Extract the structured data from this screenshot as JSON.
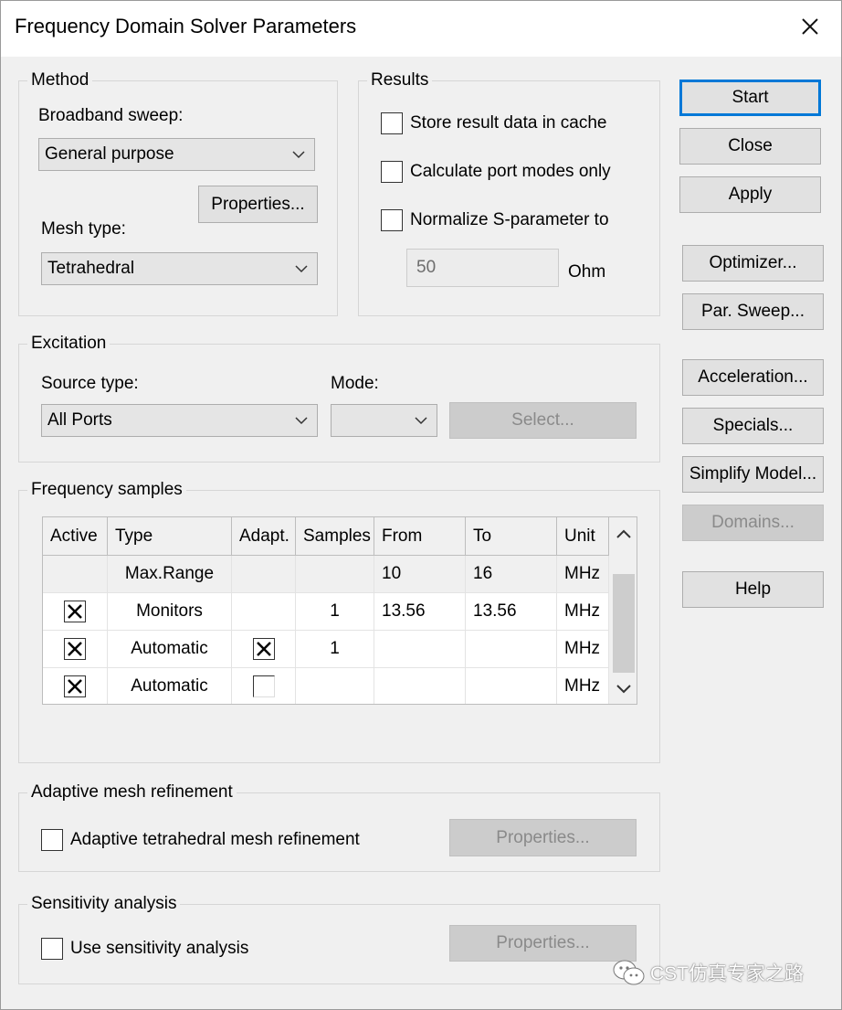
{
  "window": {
    "title": "Frequency Domain Solver Parameters"
  },
  "method": {
    "group_label": "Method",
    "broadband_label": "Broadband sweep:",
    "broadband_value": "General purpose",
    "properties_button": "Properties...",
    "mesh_label": "Mesh type:",
    "mesh_value": "Tetrahedral"
  },
  "results": {
    "group_label": "Results",
    "store_cache": {
      "label": "Store result data in cache",
      "checked": false
    },
    "port_modes": {
      "label": "Calculate port modes only",
      "checked": false
    },
    "normalize": {
      "label": "Normalize S-parameter to",
      "checked": false
    },
    "impedance_value": "50",
    "impedance_unit": "Ohm"
  },
  "side_buttons": {
    "start": "Start",
    "close": "Close",
    "apply": "Apply",
    "optimizer": "Optimizer...",
    "par_sweep": "Par. Sweep...",
    "acceleration": "Acceleration...",
    "specials": "Specials...",
    "simplify": "Simplify Model...",
    "domains": "Domains...",
    "help": "Help"
  },
  "excitation": {
    "group_label": "Excitation",
    "source_label": "Source type:",
    "source_value": "All Ports",
    "mode_label": "Mode:",
    "mode_value": "",
    "select_button": "Select..."
  },
  "frequency_samples": {
    "group_label": "Frequency samples",
    "columns": [
      "Active",
      "Type",
      "Adapt.",
      "Samples",
      "From",
      "To",
      "Unit"
    ],
    "rows": [
      {
        "active": null,
        "type": "Max.Range",
        "adapt": null,
        "samples": "",
        "from": "10",
        "to": "16",
        "unit": "MHz"
      },
      {
        "active": true,
        "type": "Monitors",
        "adapt": null,
        "samples": "1",
        "from": "13.56",
        "to": "13.56",
        "unit": "MHz"
      },
      {
        "active": true,
        "type": "Automatic",
        "adapt": true,
        "samples": "1",
        "from": "",
        "to": "",
        "unit": "MHz"
      },
      {
        "active": true,
        "type": "Automatic",
        "adapt": false,
        "samples": "",
        "from": "",
        "to": "",
        "unit": "MHz"
      }
    ]
  },
  "adaptive": {
    "group_label": "Adaptive mesh refinement",
    "checkbox_label": "Adaptive tetrahedral mesh refinement",
    "checked": false,
    "properties_button": "Properties..."
  },
  "sensitivity": {
    "group_label": "Sensitivity analysis",
    "checkbox_label": "Use sensitivity analysis",
    "checked": false,
    "properties_button": "Properties..."
  },
  "watermark": {
    "text": "CST仿真专家之路",
    "icon": "wechat-icon"
  },
  "colors": {
    "accent": "#0078d7",
    "dialog_bg": "#f0f0f0",
    "disabled_text": "#8a8a8a"
  }
}
